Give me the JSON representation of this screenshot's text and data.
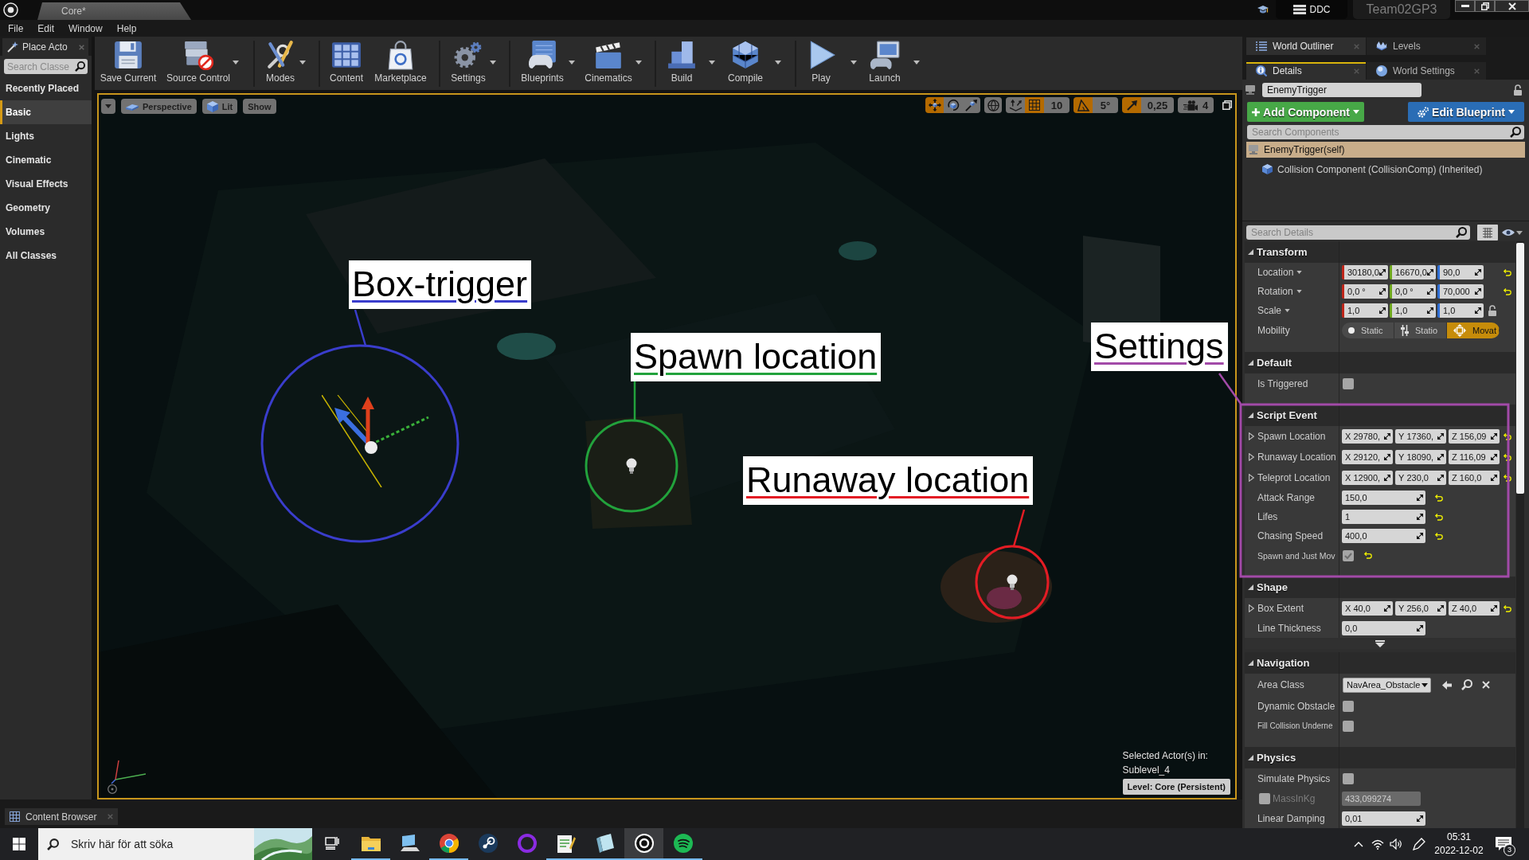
{
  "window": {
    "tab_title": "Core*",
    "ddc_button": "DDC",
    "project_name": "Team02GP3"
  },
  "menu": [
    "File",
    "Edit",
    "Window",
    "Help"
  ],
  "place_actors": {
    "tab": "Place Acto",
    "search_placeholder": "Search Classe",
    "categories": [
      {
        "label": "Recently Placed",
        "selected": false
      },
      {
        "label": "Basic",
        "selected": true
      },
      {
        "label": "Lights",
        "selected": false
      },
      {
        "label": "Cinematic",
        "selected": false
      },
      {
        "label": "Visual Effects",
        "selected": false
      },
      {
        "label": "Geometry",
        "selected": false
      },
      {
        "label": "Volumes",
        "selected": false
      },
      {
        "label": "All Classes",
        "selected": false
      }
    ]
  },
  "toolbar": [
    {
      "kind": "save",
      "label": "Save Current",
      "dropdown": false
    },
    {
      "kind": "source_control",
      "label": "Source Control",
      "dropdown": true
    },
    {
      "kind": "modes",
      "label": "Modes",
      "dropdown": true
    },
    {
      "kind": "content",
      "label": "Content",
      "dropdown": false
    },
    {
      "kind": "marketplace",
      "label": "Marketplace",
      "dropdown": false
    },
    {
      "kind": "settings",
      "label": "Settings",
      "dropdown": true
    },
    {
      "kind": "blueprints",
      "label": "Blueprints",
      "dropdown": true
    },
    {
      "kind": "cinematics",
      "label": "Cinematics",
      "dropdown": true
    },
    {
      "kind": "build",
      "label": "Build",
      "dropdown": true
    },
    {
      "kind": "compile",
      "label": "Compile",
      "dropdown": true
    },
    {
      "kind": "play",
      "label": "Play",
      "dropdown": true
    },
    {
      "kind": "launch",
      "label": "Launch",
      "dropdown": true
    }
  ],
  "viewport": {
    "view_buttons": [
      {
        "kind": "perspective",
        "label": "Perspective"
      },
      {
        "kind": "lit",
        "label": "Lit"
      },
      {
        "kind": "show",
        "label": "Show"
      }
    ],
    "transform_modes": [
      {
        "kind": "translate",
        "selected": true
      },
      {
        "kind": "rotate",
        "selected": false
      },
      {
        "kind": "scale",
        "selected": false
      }
    ],
    "snaps": [
      {
        "kind": "surface",
        "on": false
      },
      {
        "kind": "grid",
        "on": true,
        "value": "10"
      },
      {
        "kind": "rotation",
        "on": true,
        "value": "5°"
      },
      {
        "kind": "scale",
        "on": true,
        "value": "0,25"
      }
    ],
    "camera_speed": "4",
    "selection_caption": "Selected Actor(s) in:",
    "selection_level": "Sublevel_4",
    "level_badge": "Level: Core (Persistent)"
  },
  "annotations": [
    {
      "kind": "circle",
      "label": "Box-trigger",
      "color": "#3a3dcc"
    },
    {
      "kind": "circle",
      "label": "Spawn location",
      "color": "#22a23c"
    },
    {
      "kind": "circle",
      "label": "Runaway location",
      "color": "#e31c24"
    },
    {
      "kind": "frame",
      "label": "Settings",
      "color": "#a24aa8"
    }
  ],
  "outliner_tabs": [
    {
      "label": "World Outliner",
      "selected": true
    },
    {
      "label": "Levels",
      "selected": false
    }
  ],
  "details_tabs": [
    {
      "label": "Details",
      "selected": true
    },
    {
      "label": "World Settings",
      "selected": false
    }
  ],
  "details": {
    "actor_name": "EnemyTrigger",
    "add_component": "Add Component",
    "edit_blueprint": "Edit Blueprint",
    "components_placeholder": "Search Components",
    "components": [
      {
        "label": "EnemyTrigger(self)",
        "selected": true,
        "children": [
          {
            "label": "Collision Component (CollisionComp) (Inherited)",
            "selected": false
          }
        ]
      }
    ],
    "search_placeholder": "Search Details",
    "sections": [
      {
        "title": "Transform",
        "expanded": true,
        "rows": [
          {
            "kind": "transform",
            "label": "Location",
            "values": [
              "30180,0",
              "16670,0",
              "90,0"
            ],
            "reset": true
          },
          {
            "kind": "transform",
            "label": "Rotation",
            "values": [
              "0,0 °",
              "0,0 °",
              "70,000"
            ],
            "reset": true
          },
          {
            "kind": "transform",
            "label": "Scale",
            "values": [
              "1,0",
              "1,0",
              "1,0"
            ],
            "reset": false,
            "locked": false
          },
          {
            "kind": "mobility",
            "label": "Mobility",
            "options": [
              {
                "label": "Static",
                "selected": false
              },
              {
                "label": "Statio",
                "selected": false
              },
              {
                "label": "Movat",
                "selected": true
              }
            ]
          }
        ]
      },
      {
        "title": "Default",
        "expanded": true,
        "rows": [
          {
            "kind": "checkbox",
            "label": "Is Triggered",
            "checked": false,
            "reset": false
          }
        ]
      },
      {
        "title": "Script Event",
        "expanded": true,
        "rows": [
          {
            "kind": "vector",
            "label": "Spawn Location",
            "expanded": false,
            "fields": [
              {
                "axis": "X",
                "value": "29780,"
              },
              {
                "axis": "Y",
                "value": "17360,"
              },
              {
                "axis": "Z",
                "value": "156,09"
              }
            ],
            "reset": true
          },
          {
            "kind": "vector",
            "label": "Runaway Location",
            "expanded": false,
            "fields": [
              {
                "axis": "X",
                "value": "29120,"
              },
              {
                "axis": "Y",
                "value": "18090,"
              },
              {
                "axis": "Z",
                "value": "116,09"
              }
            ],
            "reset": true
          },
          {
            "kind": "vector",
            "label": "Teleprot Location",
            "expanded": false,
            "fields": [
              {
                "axis": "X",
                "value": "12900,"
              },
              {
                "axis": "Y",
                "value": "230,0"
              },
              {
                "axis": "Z",
                "value": "160,0"
              }
            ],
            "reset": true
          },
          {
            "kind": "number",
            "label": "Attack Range",
            "value": "150,0",
            "reset": true
          },
          {
            "kind": "number",
            "label": "Lifes",
            "value": "1",
            "reset": true
          },
          {
            "kind": "number",
            "label": "Chasing Speed",
            "value": "400,0",
            "reset": true
          },
          {
            "kind": "checkbox",
            "label": "Spawn and Just Mov",
            "checked": true,
            "reset": true
          }
        ]
      },
      {
        "title": "Shape",
        "expanded": true,
        "advanced_shown": false,
        "rows": [
          {
            "kind": "vector",
            "label": "Box Extent",
            "expanded": false,
            "fields": [
              {
                "axis": "X",
                "value": "40,0"
              },
              {
                "axis": "Y",
                "value": "256,0"
              },
              {
                "axis": "Z",
                "value": "40,0"
              }
            ],
            "reset": true
          },
          {
            "kind": "number",
            "label": "Line Thickness",
            "value": "0,0",
            "reset": false
          }
        ]
      },
      {
        "title": "Navigation",
        "expanded": true,
        "rows": [
          {
            "kind": "class",
            "label": "Area Class",
            "value": "NavArea_Obstacle"
          },
          {
            "kind": "checkbox",
            "label": "Dynamic Obstacle",
            "checked": false,
            "reset": false
          },
          {
            "kind": "checkbox",
            "label": "Fill Collision Underne",
            "checked": false,
            "reset": false
          }
        ]
      },
      {
        "title": "Physics",
        "expanded": true,
        "rows": [
          {
            "kind": "checkbox",
            "label": "Simulate Physics",
            "checked": false,
            "reset": false
          },
          {
            "kind": "override",
            "label": "MassInKg",
            "checked": false,
            "value": "433,099274"
          },
          {
            "kind": "number",
            "label": "Linear Damping",
            "value": "0,01",
            "reset": false
          }
        ]
      }
    ]
  },
  "bottom_tab": "Content Browser",
  "taskbar": {
    "search_placeholder": "Skriv här för att söka",
    "apps": [
      {
        "kind": "task_view",
        "running": false,
        "selected": false
      },
      {
        "kind": "explorer",
        "running": true,
        "selected": false
      },
      {
        "kind": "computer",
        "running": false,
        "selected": false
      },
      {
        "kind": "browser",
        "running": true,
        "selected": false
      },
      {
        "kind": "game_store",
        "running": false,
        "selected": false
      },
      {
        "kind": "ring",
        "running": false,
        "selected": false
      },
      {
        "kind": "text_editor",
        "running": true,
        "selected": false
      },
      {
        "kind": "notebook",
        "running": true,
        "selected": false
      },
      {
        "kind": "engine",
        "running": true,
        "selected": true
      },
      {
        "kind": "music",
        "running": true,
        "selected": false
      }
    ],
    "time": "05:31",
    "date": "2022-12-02",
    "notifications": "3"
  }
}
